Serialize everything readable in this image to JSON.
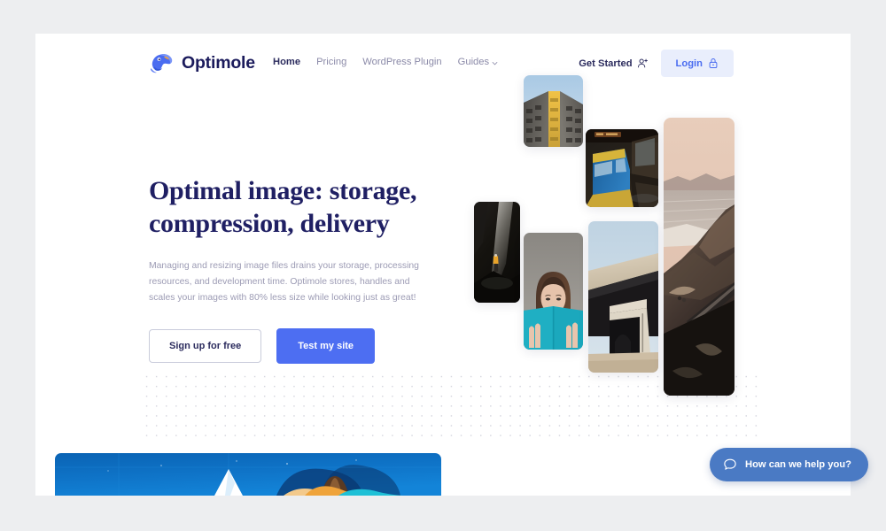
{
  "theme": {
    "page_background": "#edeef0",
    "card_background": "#ffffff",
    "brand_navy": "#1b1b5c",
    "accent_blue": "#4d6ef2",
    "login_bg": "#e9eefc",
    "muted_text": "#9c9bb4",
    "chat_blue": "#4a7ac4"
  },
  "header": {
    "brand": {
      "name": "Optimole",
      "logo_icon": "optimole-mole-logo-icon"
    },
    "nav": [
      {
        "label": "Home",
        "active": true,
        "has_chevron": false
      },
      {
        "label": "Pricing",
        "active": false,
        "has_chevron": false
      },
      {
        "label": "WordPress Plugin",
        "active": false,
        "has_chevron": false
      },
      {
        "label": "Guides",
        "active": false,
        "has_chevron": true
      }
    ],
    "get_started": {
      "label": "Get Started",
      "icon": "user-plus-icon"
    },
    "login": {
      "label": "Login",
      "icon": "lock-icon"
    }
  },
  "hero": {
    "title": "Optimal image: storage, compression, delivery",
    "description": "Managing and resizing image files drains your storage, processing resources, and development time. Optimole stores, handles and scales your images with 80% less size while looking just as great!",
    "primary_button": "Test my site",
    "secondary_button": "Sign up for free"
  },
  "collage": {
    "images": [
      {
        "name": "cave-explorer-photo",
        "alt": "Person in yellow jacket inside a dark cave"
      },
      {
        "name": "building-facade-photo",
        "alt": "Yellow and gray high-rise building facade from below"
      },
      {
        "name": "woman-reading-book-photo",
        "alt": "Woman holding a teal book over her face"
      },
      {
        "name": "train-station-photo",
        "alt": "Blue and yellow train at a station platform"
      },
      {
        "name": "concrete-architecture-photo",
        "alt": "Modern concrete building exterior"
      },
      {
        "name": "coastal-road-photo",
        "alt": "Coastal cliff road at dusk"
      }
    ]
  },
  "bottom_banner": {
    "name": "illustration-banner",
    "alt": "Blue illustration banner with a person"
  },
  "chat": {
    "label": "How can we help you?",
    "icon": "chat-bubble-icon"
  }
}
